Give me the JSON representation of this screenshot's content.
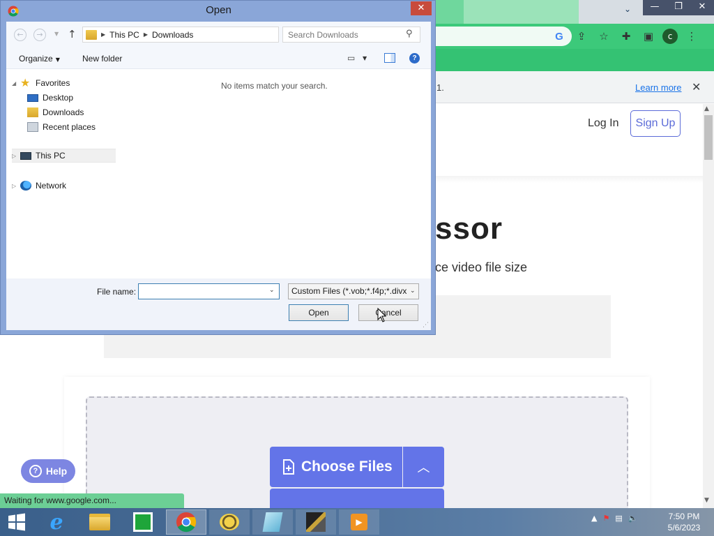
{
  "browser": {
    "infobar_text": "1.",
    "infobar_link": "Learn more",
    "profile_initial": "c",
    "status_text": "Waiting for www.google.com..."
  },
  "page": {
    "login_label": "Log In",
    "signup_label": "Sign Up",
    "title": "ssor",
    "subtitle": "ce video file size",
    "choose_files_label": "Choose Files",
    "help_label": "Help"
  },
  "dialog": {
    "title": "Open",
    "breadcrumb": [
      "This PC",
      "Downloads"
    ],
    "search_placeholder": "Search Downloads",
    "organize_label": "Organize",
    "new_folder_label": "New folder",
    "tree": {
      "favorites": "Favorites",
      "desktop": "Desktop",
      "downloads": "Downloads",
      "recent": "Recent places",
      "this_pc": "This PC",
      "network": "Network"
    },
    "empty_message": "No items match your search.",
    "file_name_label": "File name:",
    "file_name_value": "",
    "file_type_value": "Custom Files (*.vob;*.f4p;*.divx",
    "open_label": "Open",
    "cancel_label": "Cancel"
  },
  "taskbar": {
    "items": [
      "start",
      "internet-explorer",
      "file-explorer",
      "store",
      "chrome",
      "app-bee",
      "app-notepad",
      "app-tools",
      "app-video"
    ],
    "time": "7:50 PM",
    "date": "5/6/2023"
  },
  "colors": {
    "browser_accent": "#3cc97a",
    "button_primary": "#6374e8",
    "dialog_frame": "#8aa6d8",
    "close_button": "#c84b3c"
  }
}
